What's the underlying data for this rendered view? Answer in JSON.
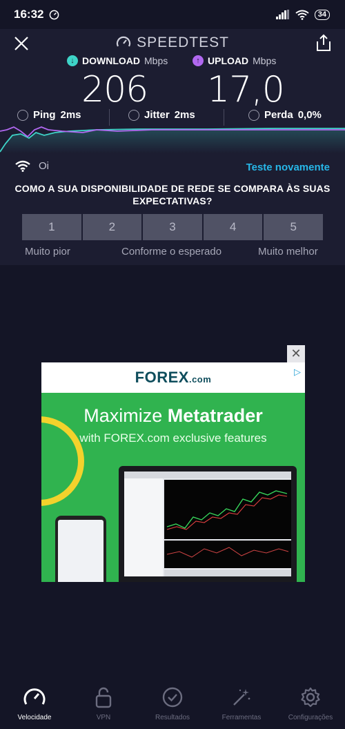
{
  "status_bar": {
    "time": "16:32",
    "battery": "34"
  },
  "header": {
    "title": "SPEEDTEST"
  },
  "download": {
    "label": "DOWNLOAD",
    "unit": "Mbps",
    "value": "206",
    "color": "#3ed4c8"
  },
  "upload": {
    "label": "UPLOAD",
    "unit": "Mbps",
    "value": "17,0",
    "color": "#b168f0"
  },
  "stats": {
    "ping_label": "Ping",
    "ping_value": "2ms",
    "jitter_label": "Jitter",
    "jitter_value": "2ms",
    "loss_label": "Perda",
    "loss_value": "0,0%"
  },
  "isp": {
    "name": "Oi",
    "retest_label": "Teste novamente"
  },
  "survey": {
    "question": "COMO A SUA DISPONIBILIDADE DE REDE SE COMPARA ÀS SUAS EXPECTATIVAS?",
    "options": [
      "1",
      "2",
      "3",
      "4",
      "5"
    ],
    "low_label": "Muito pior",
    "mid_label": "Conforme o esperado",
    "high_label": "Muito melhor"
  },
  "ad": {
    "logo_prefix": "FOREX",
    "logo_suffix": ".com",
    "headline_light": "Maximize ",
    "headline_bold": "Metatrader",
    "subline": "with FOREX.com exclusive features"
  },
  "nav": {
    "items": [
      {
        "label": "Velocidade",
        "icon": "speedometer-icon",
        "active": true
      },
      {
        "label": "VPN",
        "icon": "lock-icon",
        "active": false
      },
      {
        "label": "Resultados",
        "icon": "check-circle-icon",
        "active": false
      },
      {
        "label": "Ferramentas",
        "icon": "wand-icon",
        "active": false
      },
      {
        "label": "Configurações",
        "icon": "gear-icon",
        "active": false
      }
    ]
  }
}
